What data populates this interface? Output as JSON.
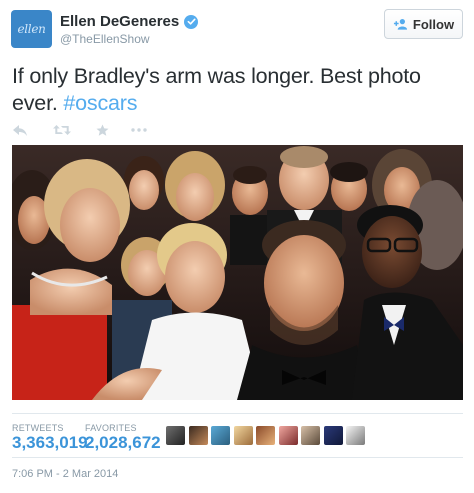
{
  "profile": {
    "avatar_text": "ellen",
    "name": "Ellen DeGeneres",
    "handle": "@TheEllenShow",
    "verified": true
  },
  "follow_button": {
    "label": "Follow"
  },
  "tweet": {
    "text": "If only Bradley's arm was longer. Best photo ever. ",
    "hashtag": "#oscars"
  },
  "actions": [
    "reply-icon",
    "retweet-icon",
    "favorite-icon",
    "more-icon"
  ],
  "stats": {
    "retweets_label": "RETWEETS",
    "retweets_value": "3,363,019",
    "favorites_label": "FAVORITES",
    "favorites_value": "2,028,672"
  },
  "favorited_by_avatars": 9,
  "timestamp": "7:06 PM - 2 Mar 2014",
  "colors": {
    "link": "#55acee",
    "stat_value": "#3b94d9",
    "muted": "#8899a6",
    "avatar_bg": "#3a86c8",
    "text": "#292f33"
  }
}
